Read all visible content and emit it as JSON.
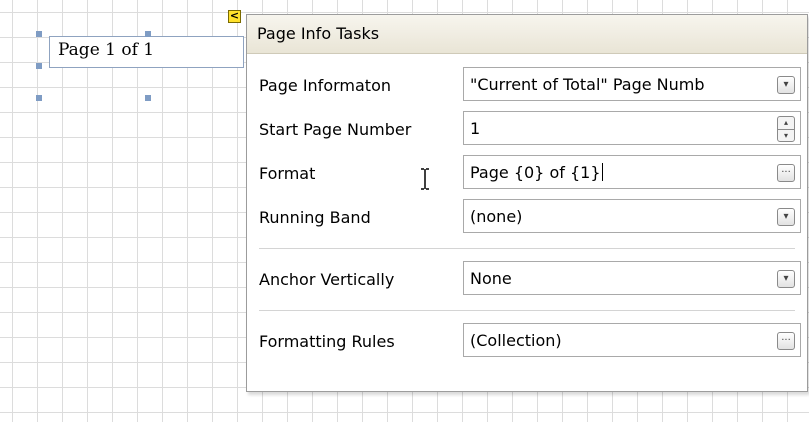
{
  "canvas": {
    "control_text": "Page 1 of 1",
    "smart_tag_glyph": "<"
  },
  "panel": {
    "title": "Page Info Tasks",
    "rows": [
      {
        "label": "Page Informaton",
        "value": "\"Current of Total\" Page Numb",
        "button": "chevron-down-icon"
      },
      {
        "label": "Start Page Number",
        "value": "1",
        "button": "spin-icon"
      },
      {
        "label": "Format",
        "value": "Page {0} of {1}",
        "button": "ellipsis-icon"
      },
      {
        "label": "Running Band",
        "value": "(none)",
        "button": "chevron-down-icon"
      },
      {
        "label": "Anchor Vertically",
        "value": "None",
        "button": "chevron-down-icon"
      },
      {
        "label": "Formatting Rules",
        "value": "(Collection)",
        "button": "ellipsis-icon"
      }
    ]
  },
  "glyphs": {
    "chevron": "▾",
    "ellipsis": "···",
    "spin_up": "▴",
    "spin_down": "▾"
  }
}
